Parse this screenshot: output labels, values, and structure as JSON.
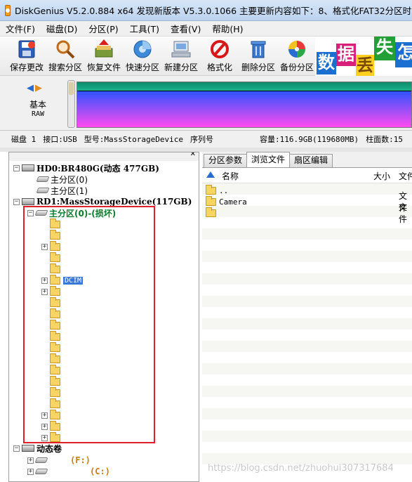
{
  "window": {
    "title": "DiskGenius V5.2.0.884 x64   发现新版本 V5.3.0.1066 主要更新内容如下：8、格式化FAT32分区时，允"
  },
  "menu": [
    "文件(F)",
    "磁盘(D)",
    "分区(P)",
    "工具(T)",
    "查看(V)",
    "帮助(H)"
  ],
  "toolbar": {
    "save": "保存更改",
    "search": "搜索分区",
    "recover": "恢复文件",
    "quick_partition": "快速分区",
    "new_partition": "新建分区",
    "format": "格式化",
    "delete_partition": "删除分区",
    "backup_partition": "备份分区"
  },
  "banner": {
    "tiles": [
      "数",
      "据",
      "丢",
      "失",
      "怎"
    ],
    "colors": [
      "#1a6fd0",
      "#d81f7a",
      "#ffd020",
      "#22a036",
      "#1a6fd0"
    ]
  },
  "disk_map": {
    "label": "基本",
    "sublabel": "RAW"
  },
  "info_line": {
    "disk": "磁盘 1",
    "interface": "接口:USB",
    "model": "型号:MassStorageDevice",
    "serial_label": "序列号",
    "capacity": "容量:116.9GB(119680MB)",
    "cylinders": "柱面数:15"
  },
  "tree": {
    "hd0": "HD0:BR480G(动态 477GB)",
    "hd0_part0": "主分区(0)",
    "hd0_part1": "主分区(1)",
    "rd1": "RD1:MassStorageDevice(117GB)",
    "rd1_part0": "主分区(0)-(损坏)",
    "dcim": "DCIM",
    "dynamic": "动态卷",
    "drive_f": "(F:)",
    "drive_c": "(C:)"
  },
  "right_tabs": [
    "分区参数",
    "浏览文件",
    "扇区编辑"
  ],
  "file_list": {
    "col_name": "名称",
    "col_size": "大小",
    "col_type": "文件",
    "rows": [
      {
        "name": "..",
        "type": ""
      },
      {
        "name": "Camera",
        "type": "文件"
      },
      {
        "name": "",
        "type": "文件"
      }
    ]
  },
  "watermark": "https://blog.csdn.net/zhuohui307317684"
}
